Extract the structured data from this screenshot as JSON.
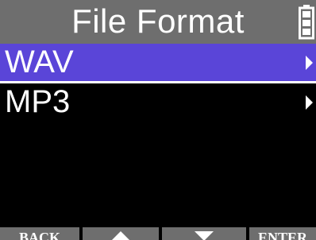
{
  "header": {
    "title": "File Format",
    "battery_icon": "battery-full-icon"
  },
  "menu": {
    "items": [
      {
        "label": "WAV",
        "selected": true,
        "arrow_icon": "chevron-right-icon"
      },
      {
        "label": "MP3",
        "selected": false,
        "arrow_icon": "chevron-right-icon"
      }
    ]
  },
  "softkeys": {
    "back_label": "BACK",
    "up_icon": "triangle-up-icon",
    "down_icon": "triangle-down-icon",
    "enter_label": "ENTER"
  },
  "colors": {
    "title_bar": "#6e6e6e",
    "selection": "#5a45d8",
    "background": "#000000",
    "text": "#ffffff"
  }
}
